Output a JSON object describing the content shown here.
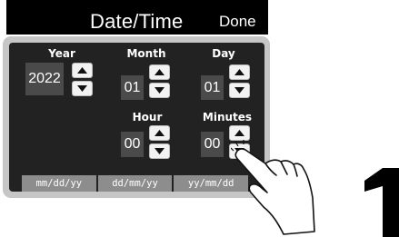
{
  "header": {
    "title": "Date/Time",
    "done_label": "Done"
  },
  "fields": {
    "year": {
      "label": "Year",
      "value": "2022"
    },
    "month": {
      "label": "Month",
      "value": "01"
    },
    "day": {
      "label": "Day",
      "value": "01"
    },
    "hour": {
      "label": "Hour",
      "value": "00"
    },
    "minutes": {
      "label": "Minutes",
      "value": "00"
    }
  },
  "formats": [
    "mm/dd/yy",
    "dd/mm/yy",
    "yy/mm/dd"
  ],
  "icons": {
    "up": "chevron-up-icon",
    "down": "chevron-down-icon"
  },
  "colors": {
    "panel": "#222222",
    "frame": "#c6c6c6",
    "value_box": "#4a4a4a",
    "format_button": "#8d8d8d"
  }
}
